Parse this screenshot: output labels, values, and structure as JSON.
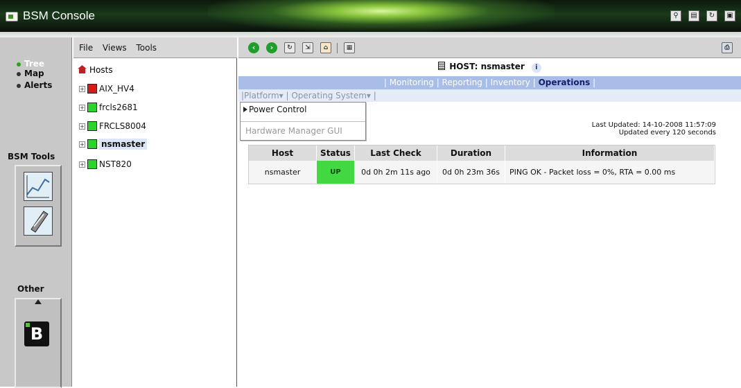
{
  "window": {
    "title": "BSM Console"
  },
  "titlebar_icons": [
    "tree-network-icon",
    "document-icon",
    "refresh-icon",
    "save-icon"
  ],
  "leftnav": {
    "items": [
      {
        "label": "Tree",
        "active": true
      },
      {
        "label": "Map",
        "active": false
      },
      {
        "label": "Alerts",
        "active": false
      }
    ],
    "tools_label": "BSM Tools",
    "other_label": "Other"
  },
  "tree_menu": {
    "file": "File",
    "views": "Views",
    "tools": "Tools"
  },
  "tree": {
    "root": "Hosts",
    "nodes": [
      {
        "label": "AIX_HV4",
        "icon_color": "#d41c1c",
        "selected": false
      },
      {
        "label": "frcls2681",
        "icon_color": "#2bd42b",
        "selected": false
      },
      {
        "label": "FRCLS8004",
        "icon_color": "#2bd42b",
        "selected": false
      },
      {
        "label": "nsmaster",
        "icon_color": "#2bd42b",
        "selected": true
      },
      {
        "label": "NST820",
        "icon_color": "#2bd42b",
        "selected": false
      }
    ]
  },
  "host_header": {
    "label": "HOST: nsmaster"
  },
  "main_tabs": {
    "monitoring": "Monitoring",
    "reporting": "Reporting",
    "inventory": "Inventory",
    "operations": "Operations"
  },
  "sub_tabs": {
    "platform": "Platform",
    "os": "Operating System"
  },
  "dropdown": {
    "power_control": "Power Control",
    "hardware_manager": "Hardware Manager GUI"
  },
  "last_updated": {
    "line1": "Last Updated: 14-10-2008 11:57:09",
    "line2": "Updated every 120 seconds"
  },
  "table": {
    "headers": {
      "host": "Host",
      "status": "Status",
      "last_check": "Last Check",
      "duration": "Duration",
      "information": "Information"
    },
    "rows": [
      {
        "host": "nsmaster",
        "status": "UP",
        "last_check": "0d 0h 2m 11s ago",
        "duration": "0d 0h 23m 36s",
        "information": "PING OK - Packet loss = 0%, RTA = 0.00 ms"
      }
    ]
  },
  "colors": {
    "status_up": "#42d842",
    "tab_bar": "#a8bde8",
    "selected_node": "#dce6f6"
  }
}
